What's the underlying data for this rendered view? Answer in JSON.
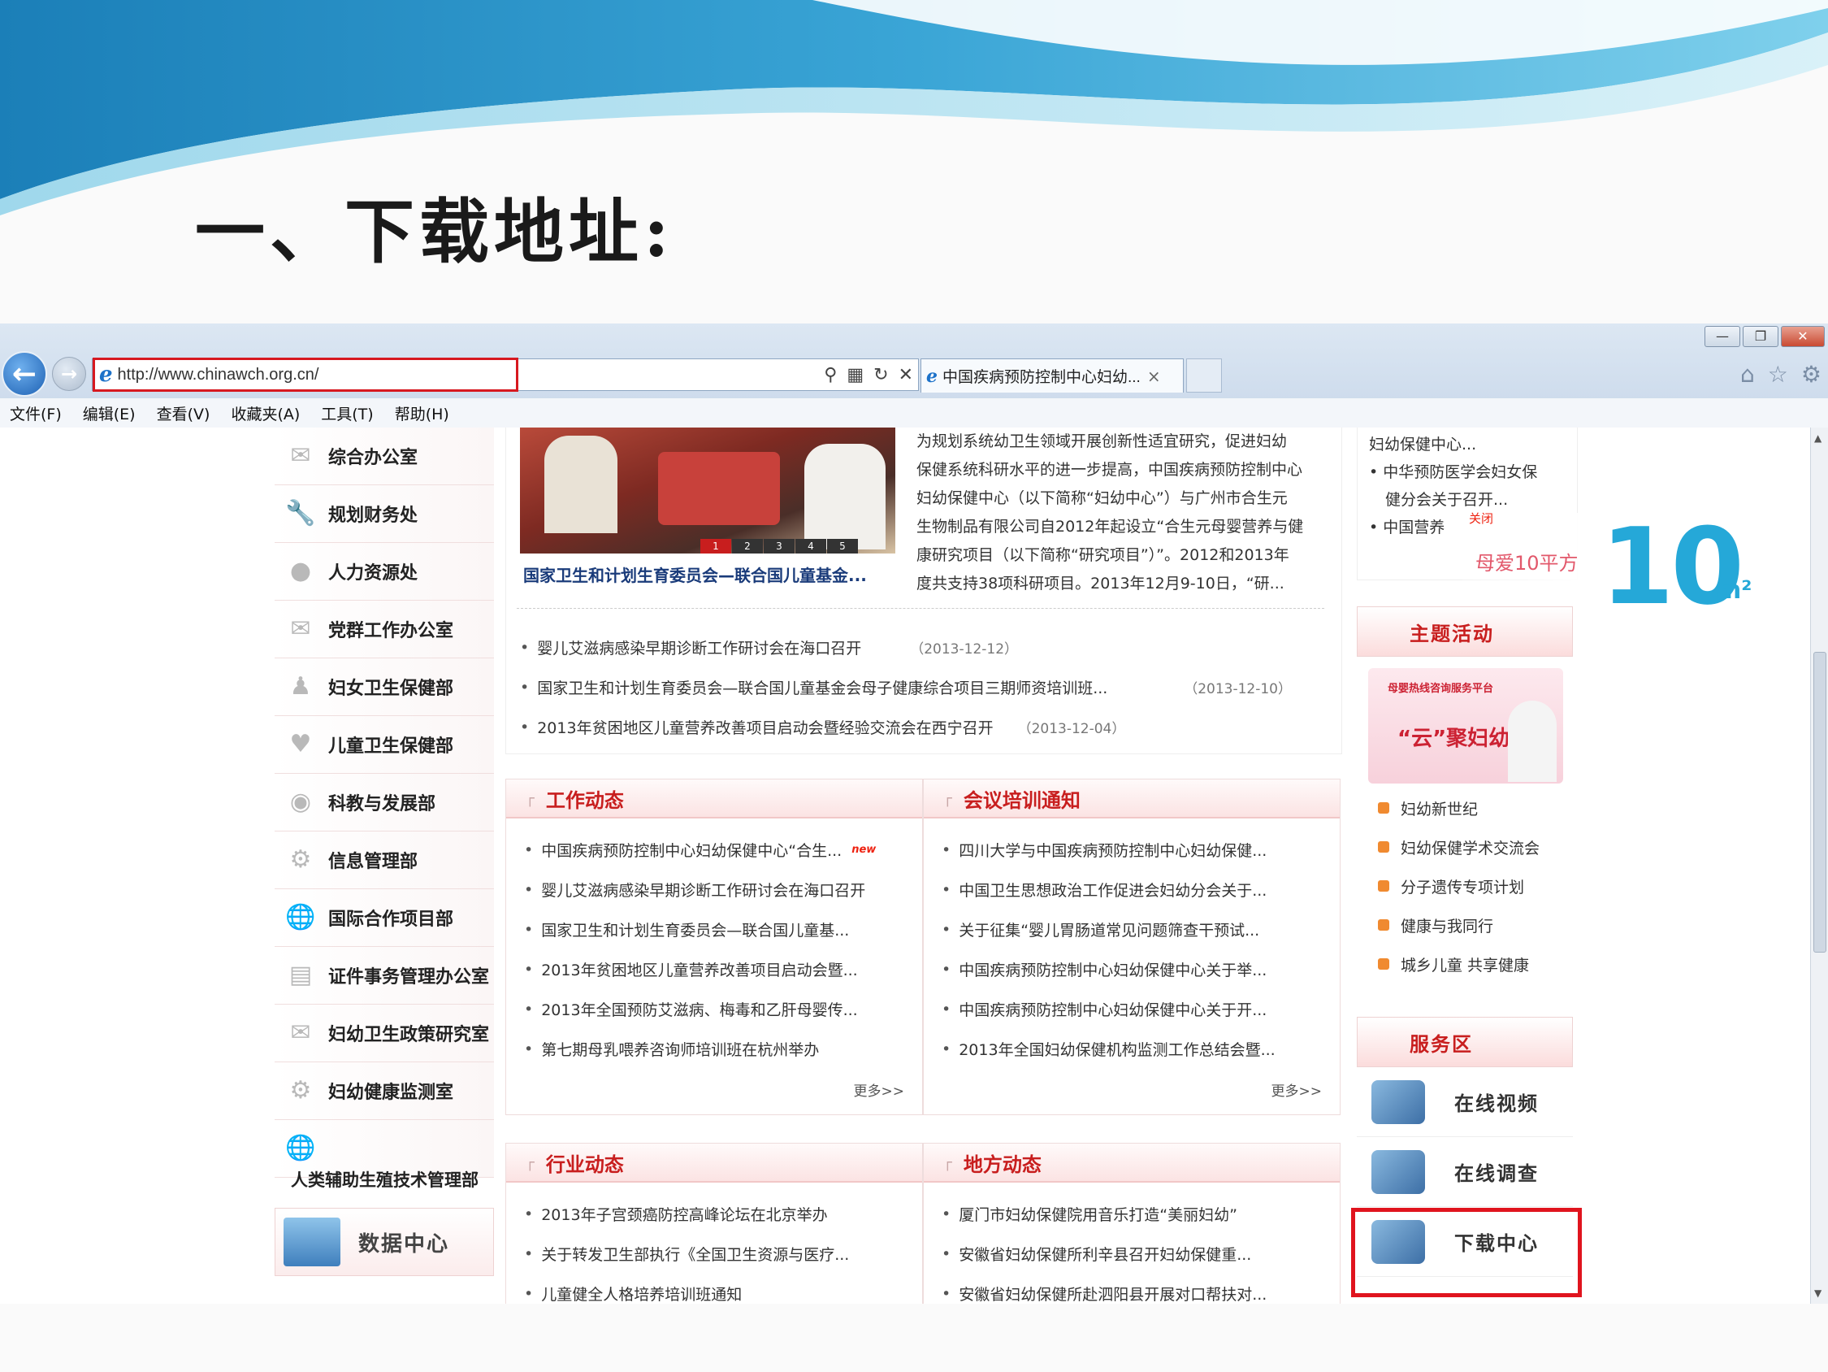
{
  "slide": {
    "title": "一、下载地址:"
  },
  "browser": {
    "window_buttons": [
      "—",
      "❐",
      "✕"
    ],
    "url": "http://www.chinawch.org.cn/",
    "tab_title": "中国疾病预防控制中心妇幼...",
    "menu": [
      "文件(F)",
      "编辑(E)",
      "查看(V)",
      "收藏夹(A)",
      "工具(T)",
      "帮助(H)"
    ]
  },
  "left_nav": {
    "items": [
      "综合办公室",
      "规划财务处",
      "人力资源处",
      "党群工作办公室",
      "妇女卫生保健部",
      "儿童卫生保健部",
      "科教与发展部",
      "信息管理部",
      "国际合作项目部",
      "证件事务管理办公室",
      "妇幼卫生政策研究室",
      "妇幼健康监测室",
      ""
    ],
    "bottom_label": "人类辅助生殖技术管理部",
    "data_center": "数据中心"
  },
  "top_news": {
    "slider_pages": [
      "1",
      "2",
      "3",
      "4",
      "5"
    ],
    "caption": "国家卫生和计划生育委员会—联合国儿童基金...",
    "body_lines": [
      "为规划系统幼卫生领域开展创新性适宜研究，促进妇幼",
      "保健系统科研水平的进一步提高，中国疾病预防控制中心",
      "妇幼保健中心（以下简称“妇幼中心”）与广州市合生元",
      "生物制品有限公司自2012年起设立“合生元母婴营养与健",
      "康研究项目（以下简称“研究项目”）”。2012和2013年",
      "度共支持38项科研项目。2013年12月9-10日，“研..."
    ],
    "headlines": [
      {
        "text": "婴儿艾滋病感染早期诊断工作研讨会在海口召开",
        "date": "（2013-12-12）"
      },
      {
        "text": "国家卫生和计划生育委员会—联合国儿童基金会母子健康综合项目三期师资培训班...",
        "date": "（2013-12-10）"
      },
      {
        "text": "2013年贫困地区儿童营养改善项目启动会暨经验交流会在西宁召开",
        "date": "（2013-12-04）"
      }
    ]
  },
  "sections": {
    "work": {
      "title": "工作动态",
      "items": [
        "中国疾病预防控制中心妇幼保健中心“合生...",
        "婴儿艾滋病感染早期诊断工作研讨会在海口召开",
        "国家卫生和计划生育委员会—联合国儿童基...",
        "2013年贫困地区儿童营养改善项目启动会暨...",
        "2013年全国预防艾滋病、梅毒和乙肝母婴传...",
        "第七期母乳喂养咨询师培训班在杭州举办"
      ],
      "new_badge": "new",
      "more": "更多>>"
    },
    "meeting": {
      "title": "会议培训通知",
      "items": [
        "四川大学与中国疾病预防控制中心妇幼保健...",
        "中国卫生思想政治工作促进会妇幼分会关于...",
        "关于征集“婴儿胃肠道常见问题筛查干预试...",
        "中国疾病预防控制中心妇幼保健中心关于举...",
        "中国疾病预防控制中心妇幼保健中心关于开...",
        "2013年全国妇幼保健机构监测工作总结会暨..."
      ],
      "more": "更多>>"
    },
    "industry": {
      "title": "行业动态",
      "items": [
        "2013年子宫颈癌防控高峰论坛在北京举办",
        "关于转发卫生部执行《全国卫生资源与医疗...",
        "儿童健全人格培养培训班通知"
      ]
    },
    "local": {
      "title": "地方动态",
      "items": [
        "厦门市妇幼保健院用音乐打造“美丽妇幼”",
        "安徽省妇幼保健所利辛县召开妇幼保健重...",
        "安徽省妇幼保健所赴泗阳县开展对口帮扶对..."
      ]
    }
  },
  "right_col": {
    "top_lines": [
      "妇幼保健中心...",
      "中华预防医学会妇女保",
      "健分会关于召开...",
      "中国营养"
    ],
    "ad": {
      "close": "关闭",
      "label": "母爱10平方",
      "big": "10",
      "unit": "m²"
    },
    "theme": {
      "title": "主题活动",
      "banner_top": "母婴热线咨询服务平台",
      "banner_main": "“云”聚妇幼",
      "links": [
        "妇幼新世纪",
        "妇幼保健学术交流会",
        "分子遗传专项计划",
        "健康与我同行",
        "城乡儿童 共享健康"
      ]
    },
    "service": {
      "title": "服务区",
      "items": [
        "在线视频",
        "在线调查",
        "下载中心"
      ]
    }
  },
  "colors": {
    "accent_red": "#c81e1e",
    "highlight": "#e0141e",
    "link_blue": "#1a3b7a",
    "brand_cyan": "#25a8d8"
  }
}
